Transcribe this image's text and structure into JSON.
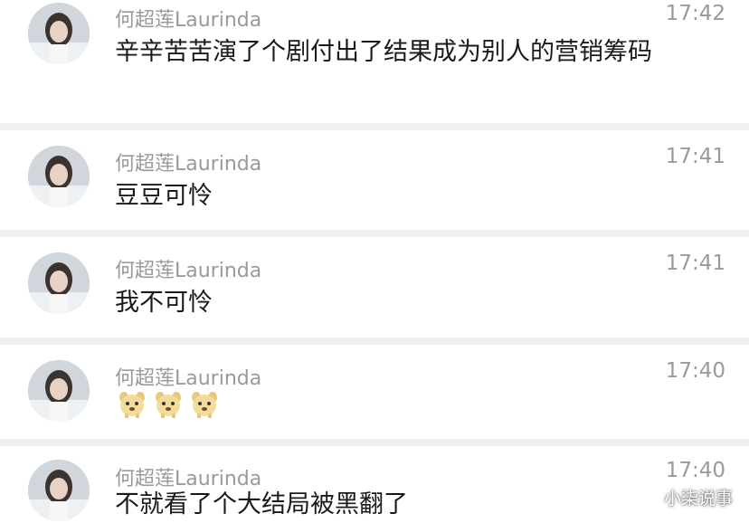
{
  "messages": [
    {
      "user": "何超莲Laurinda",
      "time": "17:42",
      "text": "辛辛苦苦演了个剧付出了结果成为别人的营销筹码"
    },
    {
      "user": "何超莲Laurinda",
      "time": "17:41",
      "text": "豆豆可怜"
    },
    {
      "user": "何超莲Laurinda",
      "time": "17:41",
      "text": "我不可怜"
    },
    {
      "user": "何超莲Laurinda",
      "time": "17:40",
      "text": "",
      "emoji": "dog-face-emoji",
      "emoji_count": 3
    },
    {
      "user": "何超莲Laurinda",
      "time": "17:40",
      "text": "不就看了个大结局被黑翻了"
    }
  ],
  "watermark": "小柒说事",
  "colors": {
    "background": "#ffffff",
    "separator": "#f0f0f2",
    "meta_text": "#9a9a9a",
    "body_text": "#1a1a1a"
  }
}
